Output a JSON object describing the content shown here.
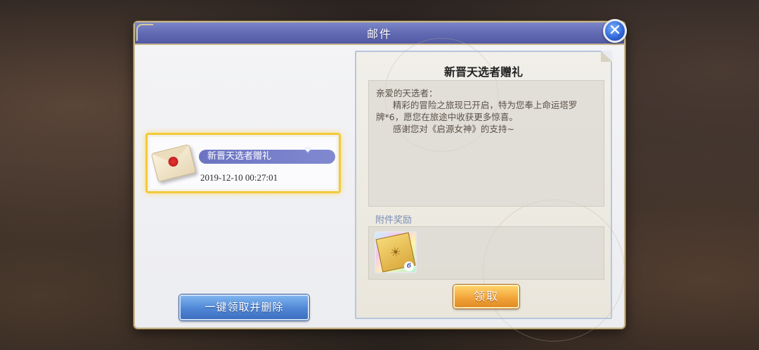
{
  "window": {
    "title": "邮件"
  },
  "mail_list": [
    {
      "subject": "新晋天选者赠礼",
      "date": "2019-12-10  00:27:01",
      "selected": true,
      "icon": "envelope-icon"
    }
  ],
  "buttons": {
    "claim_all_label": "一键领取并删除",
    "claim_label": "领取",
    "close_icon": "close-icon"
  },
  "detail": {
    "title": "新晋天选者赠礼",
    "body_lines": [
      "亲爱的天选者：",
      "      精彩的冒险之旅现已开启，特为您奉上命运塔罗",
      "牌*6，愿您在旅途中收获更多惊喜。",
      "      感谢您对《启源女神》的支持~"
    ],
    "attachment_label": "附件奖励",
    "attachments": [
      {
        "icon": "tarot-card-icon",
        "count": "6"
      }
    ]
  },
  "colors": {
    "titlebar": "#5f68b0",
    "selection_border": "#f3c93b",
    "claim_all_button": "#4f86d5",
    "claim_button": "#f2a53a"
  }
}
